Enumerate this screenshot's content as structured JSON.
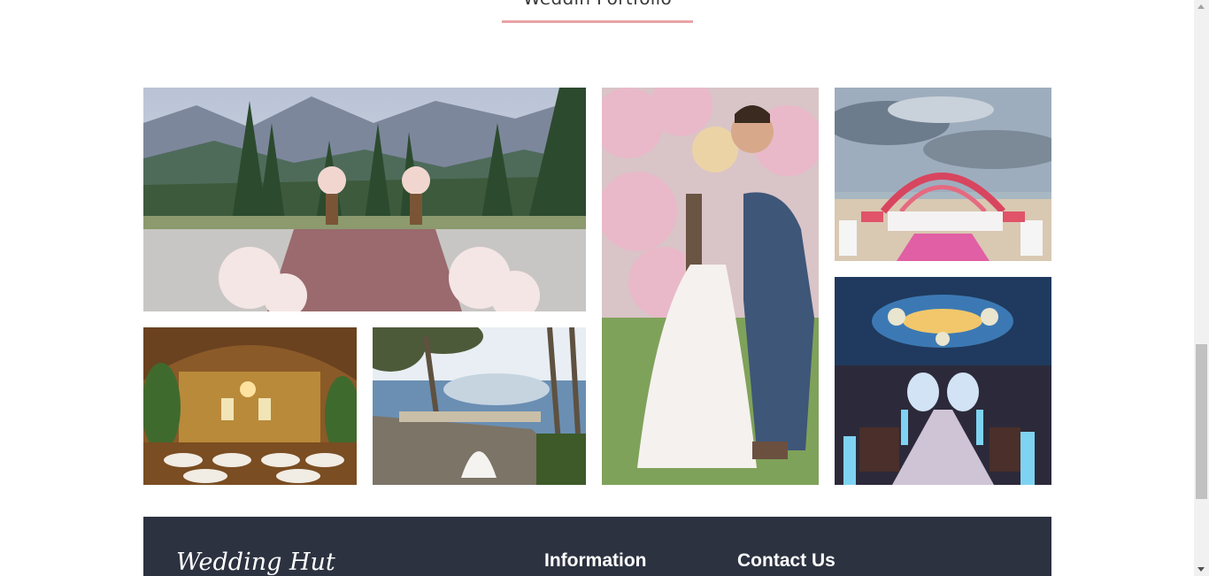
{
  "portfolio": {
    "title": "Weddin Portfolio",
    "accent_color": "#e8a4a6",
    "photos": [
      {
        "name": "mountain-ceremony-photo"
      },
      {
        "name": "couple-blossom-photo"
      },
      {
        "name": "beach-mandap-photo"
      },
      {
        "name": "great-hall-reception-photo"
      },
      {
        "name": "lakeside-terrace-photo"
      },
      {
        "name": "ballroom-aisle-photo"
      }
    ]
  },
  "footer": {
    "brand": "Wedding Hut",
    "information_title": "Information",
    "contact_title": "Contact Us",
    "background_color": "#2c3240"
  }
}
